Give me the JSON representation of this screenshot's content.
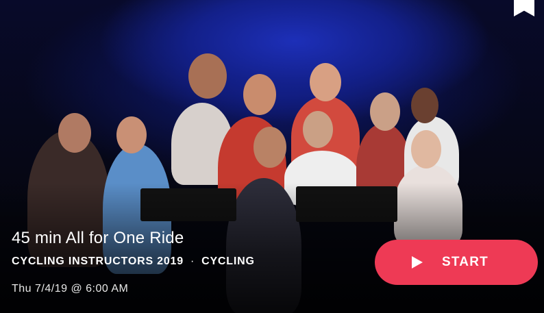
{
  "class": {
    "title": "45 min All for One Ride",
    "series": "CYCLING INSTRUCTORS 2019",
    "separator": "·",
    "discipline": "CYCLING",
    "datetime": "Thu 7/4/19 @ 6:00 AM"
  },
  "actions": {
    "start_label": "START",
    "bookmark_icon": "bookmark-icon",
    "play_icon": "play-icon"
  },
  "colors": {
    "accent": "#ee3a55",
    "studio_blue": "#13208a"
  }
}
